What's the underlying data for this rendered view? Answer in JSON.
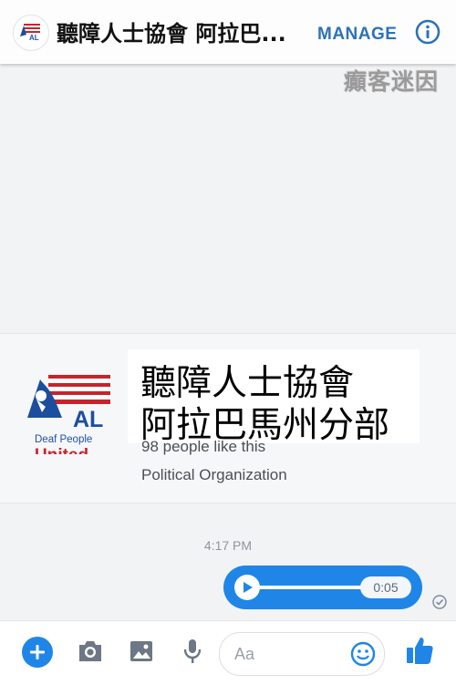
{
  "header": {
    "title": "聽障人士協會 阿拉巴...",
    "manage_label": "MANAGE",
    "logo_text": "AL"
  },
  "watermark": "癲客迷因",
  "page_card": {
    "logo": {
      "top_text": "AL",
      "middle_text": "Deaf People",
      "bottom_text": "United"
    },
    "name_line1": "聽障人士協會",
    "name_line2": "阿拉巴馬州分部",
    "likes": "98 people like this",
    "category": "Political Organization"
  },
  "messages": {
    "timestamp": "4:17 PM",
    "audio": {
      "duration": "0:05",
      "progress": 0
    }
  },
  "composer": {
    "placeholder": "Aa"
  },
  "colors": {
    "accent": "#1f86e8",
    "manage": "#2d72b7",
    "logo_red": "#c8232c",
    "logo_blue": "#1d4e9e"
  },
  "icons": [
    "info-icon",
    "play-icon",
    "seen-check-icon",
    "plus-icon",
    "camera-icon",
    "image-icon",
    "microphone-icon",
    "emoji-icon",
    "thumbs-up-icon"
  ]
}
